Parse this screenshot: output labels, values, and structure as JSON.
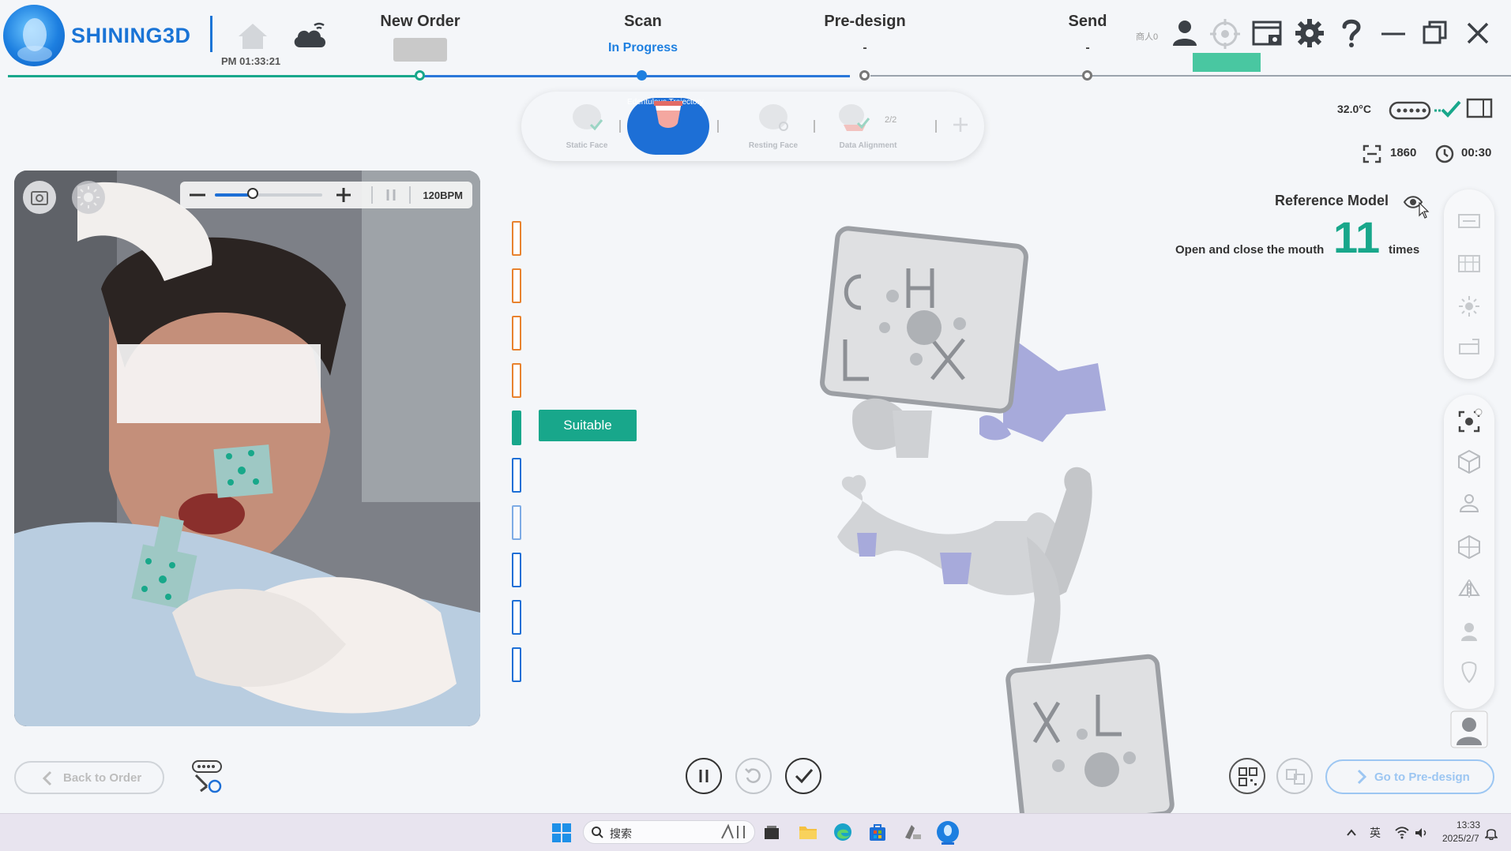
{
  "header": {
    "brand": "SHINING3D",
    "time": "PM 01:33:21",
    "steps": [
      {
        "label": "New Order",
        "sub": ""
      },
      {
        "label": "Scan",
        "sub": "In Progress"
      },
      {
        "label": "Pre-design",
        "sub": "-"
      },
      {
        "label": "Send",
        "sub": "-"
      }
    ],
    "user_small": "商人0"
  },
  "substeps": [
    {
      "label": "Static Face"
    },
    {
      "label": "Edentulous Trajectory"
    },
    {
      "label": "Resting Face"
    },
    {
      "label": "Data Alignment"
    }
  ],
  "substep_count": "2/2",
  "status": {
    "temperature": "32.0°C",
    "frames": "1860",
    "timer": "00:30"
  },
  "camera": {
    "bpm": "120BPM",
    "slider_level": 0.35
  },
  "indicator": {
    "suitable_label": "Suitable",
    "orange_count": 4,
    "active_index": 4,
    "total": 10
  },
  "reference": {
    "label": "Reference Model",
    "instruction": "Open and close the mouth",
    "count": "11",
    "unit": "times"
  },
  "buttons": {
    "back": "Back to Order",
    "go_predesign": "Go to Pre-design"
  },
  "taskbar": {
    "search": "搜索",
    "lang": "英",
    "clock_time": "13:33",
    "clock_date": "2025/2/7"
  },
  "colors": {
    "accent_blue": "#1d6fd6",
    "accent_green": "#18a78b",
    "orange": "#e8822e"
  }
}
